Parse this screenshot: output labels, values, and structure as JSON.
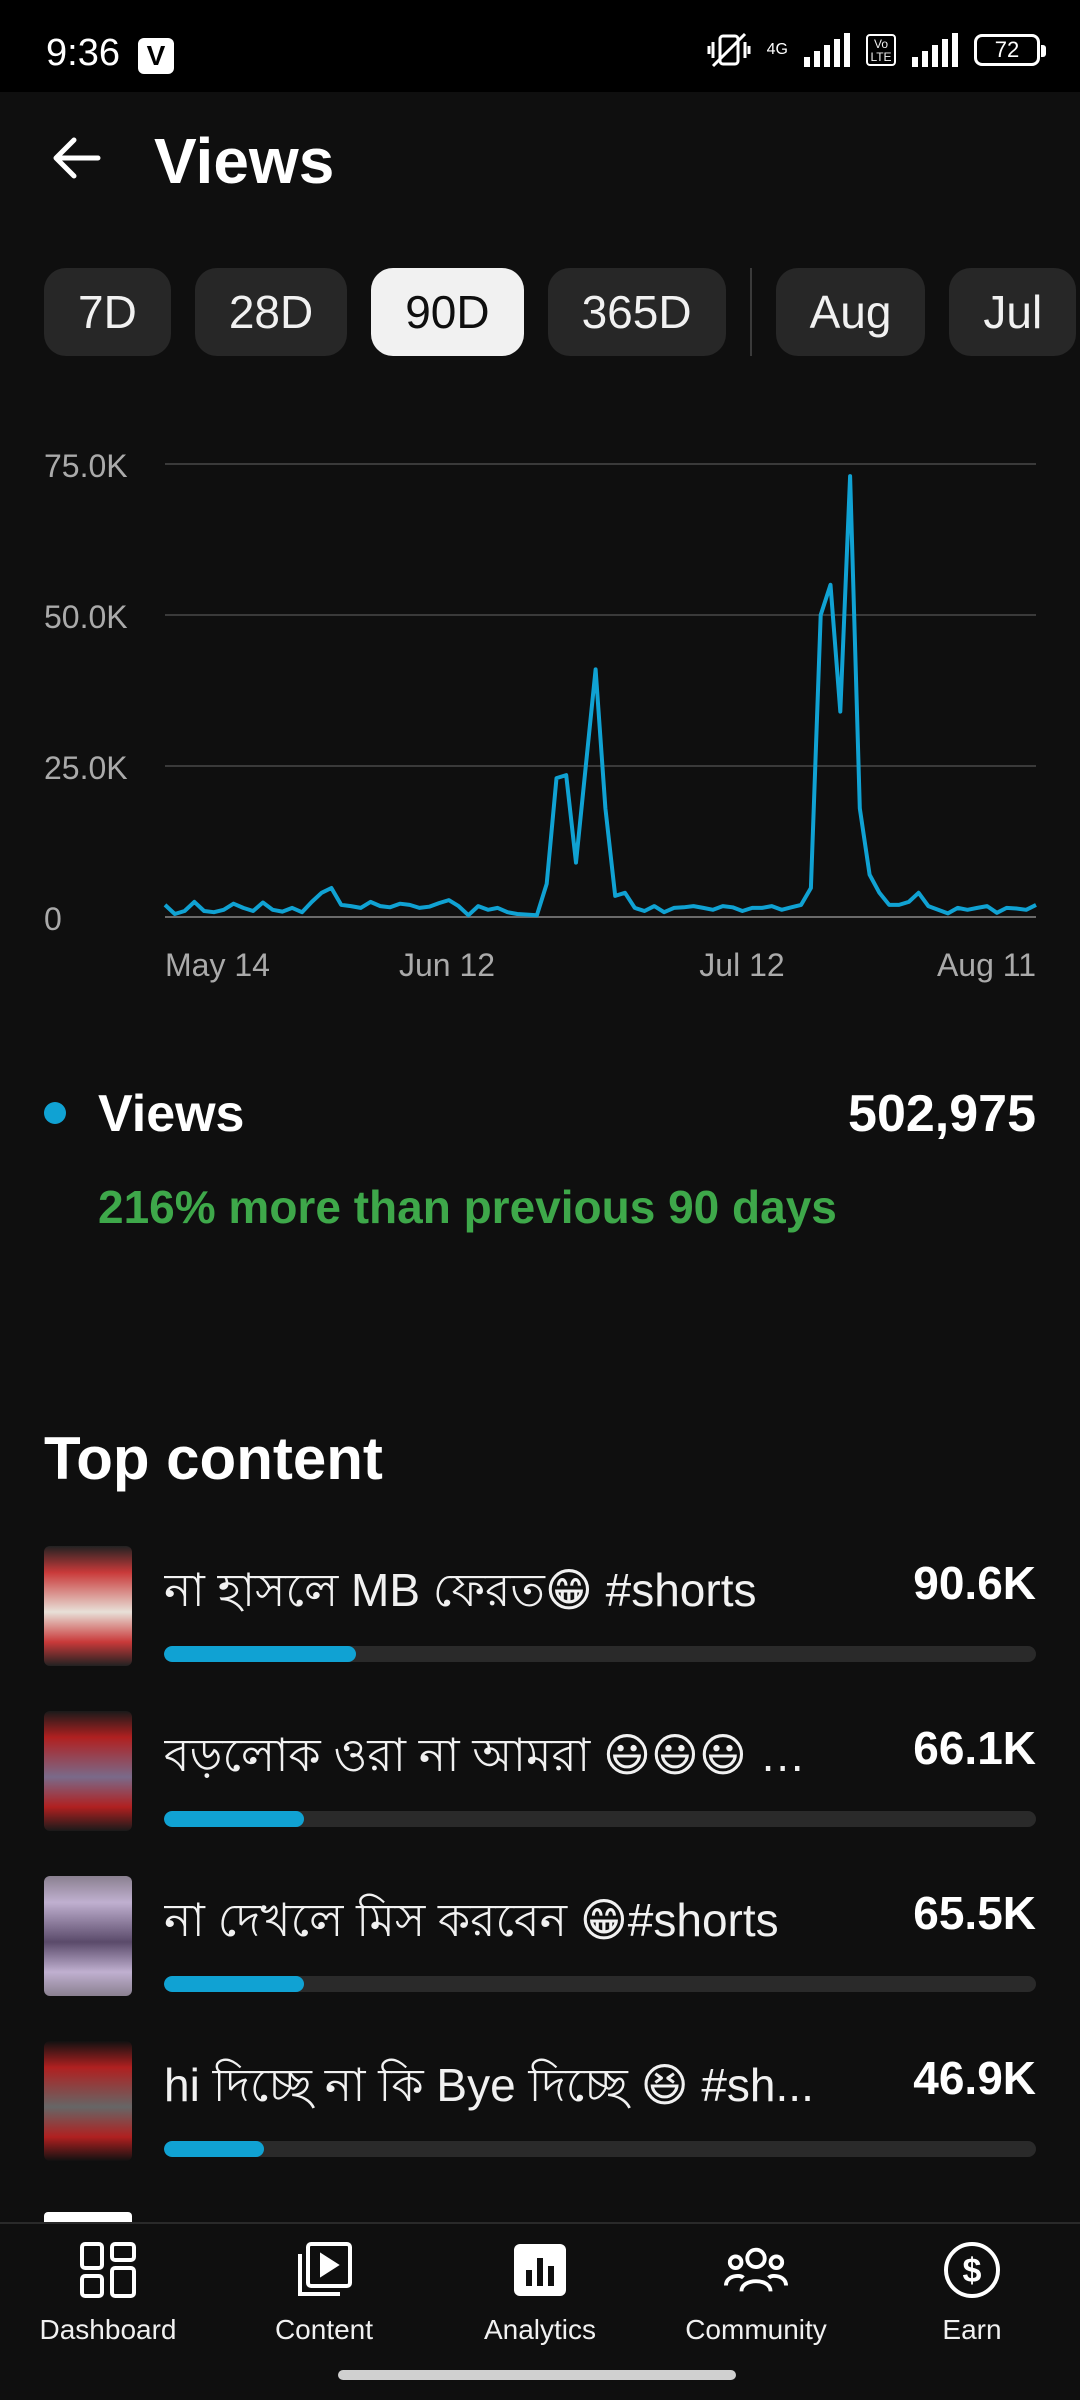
{
  "status_bar": {
    "time": "9:36",
    "v_badge": "V",
    "network": "4G",
    "volte": "Vo LTE",
    "battery": "72"
  },
  "header": {
    "title": "Views"
  },
  "ranges": [
    "7D",
    "28D",
    "90D",
    "365D",
    "Aug",
    "Jul"
  ],
  "active_range": "90D",
  "chart_data": {
    "type": "line",
    "series": [
      {
        "name": "Views",
        "color": "#10a2d3",
        "values": [
          2000,
          500,
          1000,
          2500,
          1000,
          800,
          1200,
          2200,
          1500,
          1000,
          2400,
          1200,
          900,
          1500,
          800,
          2500,
          4000,
          4800,
          2000,
          1800,
          1500,
          2500,
          1800,
          1600,
          2200,
          2000,
          1500,
          1700,
          2300,
          2800,
          1800,
          300,
          1800,
          1200,
          1500,
          800,
          500,
          400,
          300,
          5500,
          23000,
          23500,
          9000,
          25000,
          41000,
          18000,
          3500,
          4000,
          1500,
          1000,
          1800,
          800,
          1500,
          1600,
          1800,
          1500,
          1200,
          1800,
          1600,
          1000,
          1500,
          1500,
          1800,
          1200,
          1600,
          2000,
          4800,
          50000,
          55000,
          34000,
          73000,
          18000,
          7000,
          4000,
          2000,
          2000,
          2500,
          4000,
          1800,
          1200,
          600,
          1500,
          1200,
          1500,
          1800,
          700,
          1500,
          1400,
          1200,
          2000
        ]
      }
    ],
    "x_tick_labels": [
      "May 14",
      "Jun 12",
      "Jul 12",
      "Aug 11"
    ],
    "y_tick_labels": [
      "0",
      "25.0K",
      "50.0K",
      "75.0K"
    ],
    "ylim": [
      0,
      75000
    ],
    "grid": true,
    "title": "",
    "xlabel": "",
    "ylabel": ""
  },
  "metric": {
    "label": "Views",
    "value": "502,975",
    "comparison": "216% more than previous 90 days",
    "comparison_color": "#3ea84a"
  },
  "top_content": {
    "title": "Top content",
    "items": [
      {
        "title": "না হাসলে MB ফেরত😁 #shorts",
        "value": "90.6K",
        "share": 0.22,
        "thumb_colors": [
          "#222",
          "#c93a3a",
          "#e8e0d8"
        ]
      },
      {
        "title": "বড়লোক ওরা না আমরা 😃😃😃 …",
        "value": "66.1K",
        "share": 0.16,
        "thumb_colors": [
          "#1a1a1a",
          "#b02020",
          "#7a6a8a"
        ]
      },
      {
        "title": "না দেখলে মিস করবেন 😁#shorts",
        "value": "65.5K",
        "share": 0.16,
        "thumb_colors": [
          "#8a8090",
          "#c0b0d0",
          "#5a4a6a"
        ]
      },
      {
        "title": "hi দিচ্ছে না কি Bye দিচ্ছে 😆 #sh...",
        "value": "46.9K",
        "share": 0.115,
        "thumb_colors": [
          "#111",
          "#b02020",
          "#666"
        ]
      }
    ]
  },
  "bottom_nav": [
    {
      "label": "Dashboard",
      "icon": "dashboard-icon"
    },
    {
      "label": "Content",
      "icon": "content-icon"
    },
    {
      "label": "Analytics",
      "icon": "analytics-icon"
    },
    {
      "label": "Community",
      "icon": "community-icon"
    },
    {
      "label": "Earn",
      "icon": "earn-icon"
    }
  ]
}
